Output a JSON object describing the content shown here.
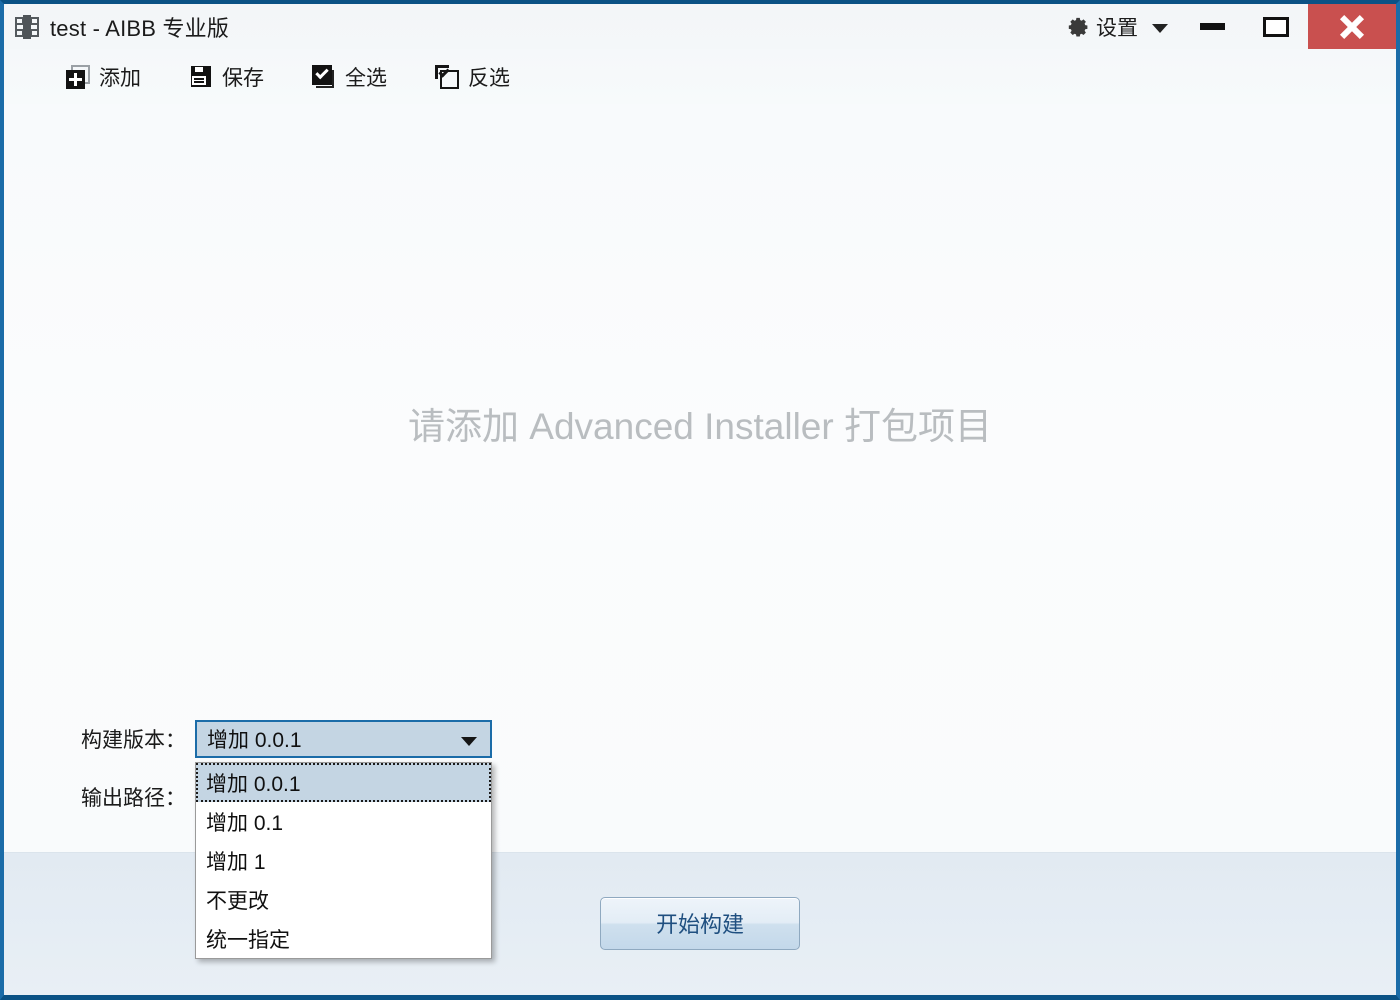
{
  "window": {
    "title": "test - AIBB 专业版",
    "app_icon": "package-icon",
    "accent_border": "#1b6ca8",
    "title_border": "#0b5285",
    "close_button_color": "#c9504f"
  },
  "titlebar": {
    "settings": {
      "label": "设置",
      "icon": "gear-icon",
      "caret": "chevron-down-icon"
    },
    "minimize": {
      "icon": "minimize-icon",
      "label": ""
    },
    "maximize": {
      "icon": "maximize-icon",
      "label": ""
    },
    "close": {
      "icon": "close-icon",
      "label": ""
    }
  },
  "toolbar": {
    "items": [
      {
        "label": "添加",
        "icon": "add-item-icon"
      },
      {
        "label": "保存",
        "icon": "save-floppy-icon"
      },
      {
        "label": "全选",
        "icon": "select-all-checkbox-icon"
      },
      {
        "label": "反选",
        "icon": "invert-selection-checkbox-icon"
      }
    ]
  },
  "content": {
    "empty_hint": "请添加 Advanced Installer 打包项目",
    "empty_hint_color": "#b9bdc0"
  },
  "form": {
    "version_label": "构建版本：",
    "output_label": "输出路径：",
    "version_combo": {
      "value": "增加 0.0.1",
      "arrow": "chevron-down-icon",
      "expanded": true,
      "selected_index": 0,
      "options": [
        "增加 0.0.1",
        "增加 0.1",
        "增加 1",
        "不更改",
        "统一指定"
      ],
      "fill_color": "#c4d5e3",
      "border_color": "#1b6ca8"
    }
  },
  "bottom": {
    "build_button": "开始构建",
    "build_button_text_color": "#1f4f80"
  }
}
